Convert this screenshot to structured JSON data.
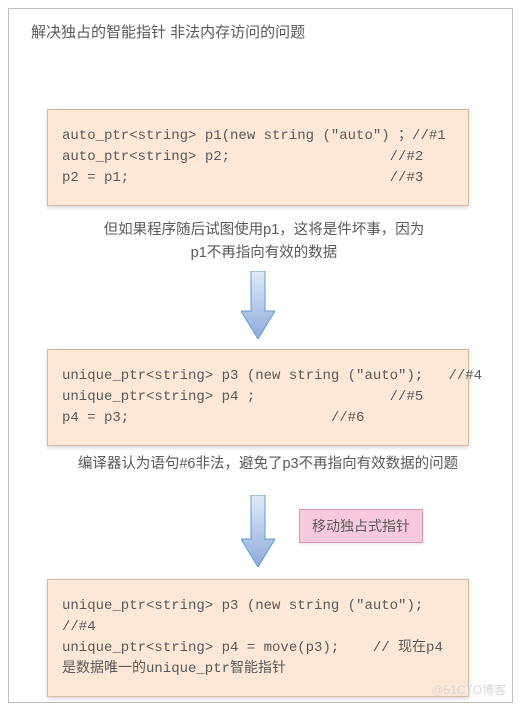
{
  "title": "解决独占的智能指针 非法内存访问的问题",
  "code1": "auto_ptr<string> p1(new string (\"auto\") ；//#1\nauto_ptr<string> p2;                   //#2\np2 = p1;                               //#3",
  "caption1": "但如果程序随后试图使用p1，这将是件坏事，因为p1不再指向有效的数据",
  "code2": "unique_ptr<string> p3 (new string (\"auto\");   //#4\nunique_ptr<string> p4 ;                //#5\np4 = p3;                        //#6",
  "caption2": "编译器认为语句#6非法，避免了p3不再指向有效数据的问题",
  "tag": "移动独占式指针",
  "code3": "unique_ptr<string> p3 (new string (\"auto\");   //#4\nunique_ptr<string> p4 = move(p3);    // 现在p4是数据唯一的unique_ptr智能指针",
  "watermark": "@51CTO博客",
  "colors": {
    "codebox_bg": "#fde8d7",
    "codebox_border": "#d6b9a0",
    "tag_bg": "#f9cadb",
    "tag_border": "#d99bb5",
    "arrow_fill1": "#bdd7ee",
    "arrow_fill2": "#8faadc",
    "arrow_stroke": "#5b9bd5",
    "text": "#595959"
  }
}
